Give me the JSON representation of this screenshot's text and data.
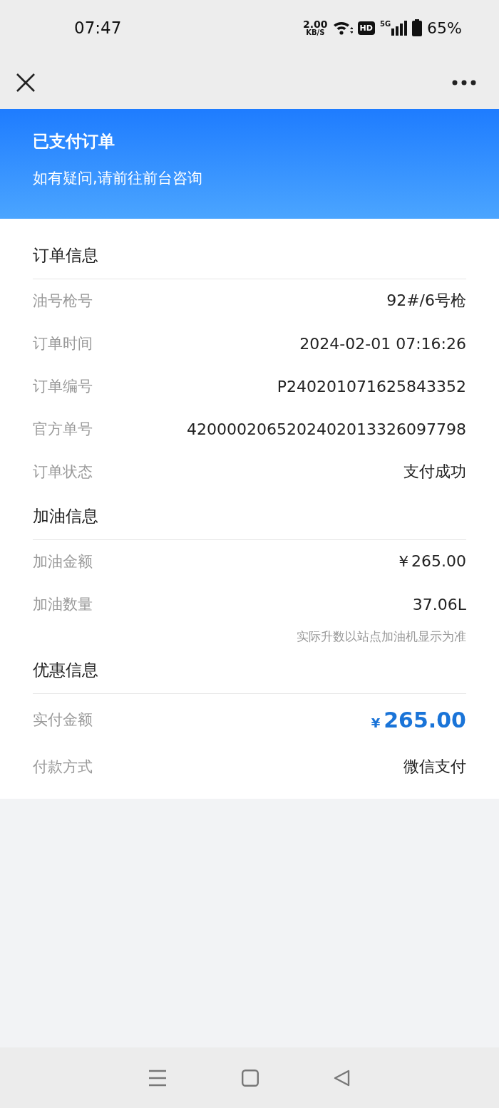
{
  "status_bar": {
    "time": "07:47",
    "speed_value": "2.00",
    "speed_unit": "KB/S",
    "hd_badge": "HD",
    "network": "5G",
    "battery": "65%"
  },
  "banner": {
    "title": "已支付订单",
    "subtitle": "如有疑问,请前往前台咨询"
  },
  "sections": [
    {
      "title": "订单信息",
      "rows": [
        {
          "kind": "plain",
          "label": "油号枪号",
          "value": "92#/6号枪"
        },
        {
          "kind": "plain",
          "label": "订单时间",
          "value": "2024-02-01 07:16:26"
        },
        {
          "kind": "plain",
          "label": "订单编号",
          "value": "P240201071625843352"
        },
        {
          "kind": "plain",
          "label": "官方单号",
          "value": "4200002065202402013326097798"
        },
        {
          "kind": "plain",
          "label": "订单状态",
          "value": "支付成功"
        }
      ]
    },
    {
      "title": "加油信息",
      "rows": [
        {
          "kind": "plain",
          "label": "加油金额",
          "value": "￥265.00"
        },
        {
          "kind": "plain",
          "label": "加油数量",
          "value": "37.06L"
        },
        {
          "kind": "note",
          "value": "实际升数以站点加油机显示为准"
        }
      ]
    },
    {
      "title": "优惠信息",
      "rows": [
        {
          "kind": "price",
          "label": "实付金额",
          "currency": "¥",
          "value": "265.00"
        },
        {
          "kind": "plain",
          "label": "付款方式",
          "value": "微信支付"
        }
      ]
    }
  ]
}
